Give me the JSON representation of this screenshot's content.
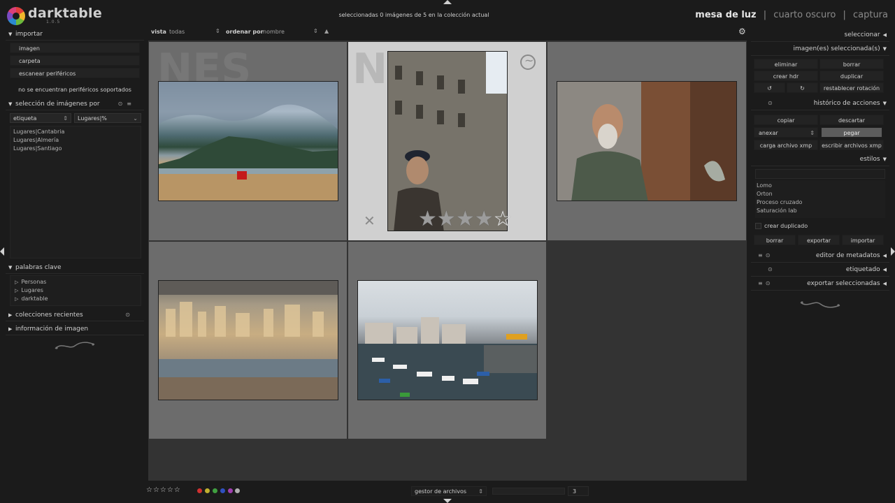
{
  "app": {
    "name": "darktable",
    "version": "1.0.5"
  },
  "header": {
    "collection_info": "seleccionadas 0 imágenes de 5 en la colección actual",
    "views": {
      "active": "mesa de luz",
      "darkroom": "cuarto oscuro",
      "capture": "captura",
      "separator": "|"
    }
  },
  "left": {
    "import": {
      "title": "importar",
      "buttons": [
        "imagen",
        "carpeta",
        "escanear periféricos"
      ],
      "note": "no se encuentran periféricos soportados"
    },
    "collect": {
      "title": "selección de imágenes por",
      "property": "etiqueta",
      "rule": "Lugares|%",
      "items": [
        "Lugares|Cantabria",
        "Lugares|Almería",
        "Lugares|Santiago"
      ]
    },
    "keywords": {
      "title": "palabras clave",
      "items": [
        "Personas",
        "Lugares",
        "darktable"
      ]
    },
    "recent": {
      "title": "colecciones recientes"
    },
    "info": {
      "title": "información de imagen"
    }
  },
  "toolbar": {
    "view_label": "vista",
    "view_value": "todas",
    "sort_label": "ordenar por",
    "sort_value": "nombre",
    "sort_dir": "▲"
  },
  "thumbnails": [
    {
      "name": "beach-mountain",
      "stars": 0,
      "hover": false
    },
    {
      "name": "old-man-cathedral",
      "stars": 4,
      "hover": true
    },
    {
      "name": "bearded-man-door",
      "stars": 0,
      "hover": false
    },
    {
      "name": "city-harbor",
      "stars": 0,
      "hover": false
    },
    {
      "name": "marina-boats",
      "stars": 0,
      "hover": false
    }
  ],
  "bottom": {
    "star_filter": "☆☆☆☆☆",
    "color_labels": [
      "#d03030",
      "#c0b030",
      "#40a040",
      "#3050c0",
      "#a040b0",
      "#b0b0b0"
    ],
    "storage": "gestor de archivos",
    "zoom": "3"
  },
  "right": {
    "select": {
      "title": "seleccionar"
    },
    "selected_images": {
      "title": "imagen(es) seleccionada(s)",
      "buttons": {
        "remove": "eliminar",
        "delete": "borrar",
        "create_hdr": "crear hdr",
        "duplicate": "duplicar",
        "rotate_ccw": "↺",
        "rotate_cw": "↻",
        "reset_rotation": "restablecer rotación"
      }
    },
    "history": {
      "title": "histórico de acciones",
      "buttons": {
        "copy": "copiar",
        "discard": "descartar",
        "mode": "anexar",
        "paste": "pegar",
        "load_xmp": "carga archivo xmp",
        "write_xmp": "escribir archivos xmp"
      }
    },
    "styles": {
      "title": "estilos",
      "items": [
        "Lomo",
        "Orton",
        "Proceso cruzado",
        "Saturación lab"
      ],
      "create_duplicate": "crear duplicado",
      "buttons": {
        "delete": "borrar",
        "export": "exportar",
        "import": "importar"
      }
    },
    "metadata": {
      "title": "editor de metadatos"
    },
    "tagging": {
      "title": "etiquetado"
    },
    "export": {
      "title": "exportar seleccionadas"
    }
  }
}
